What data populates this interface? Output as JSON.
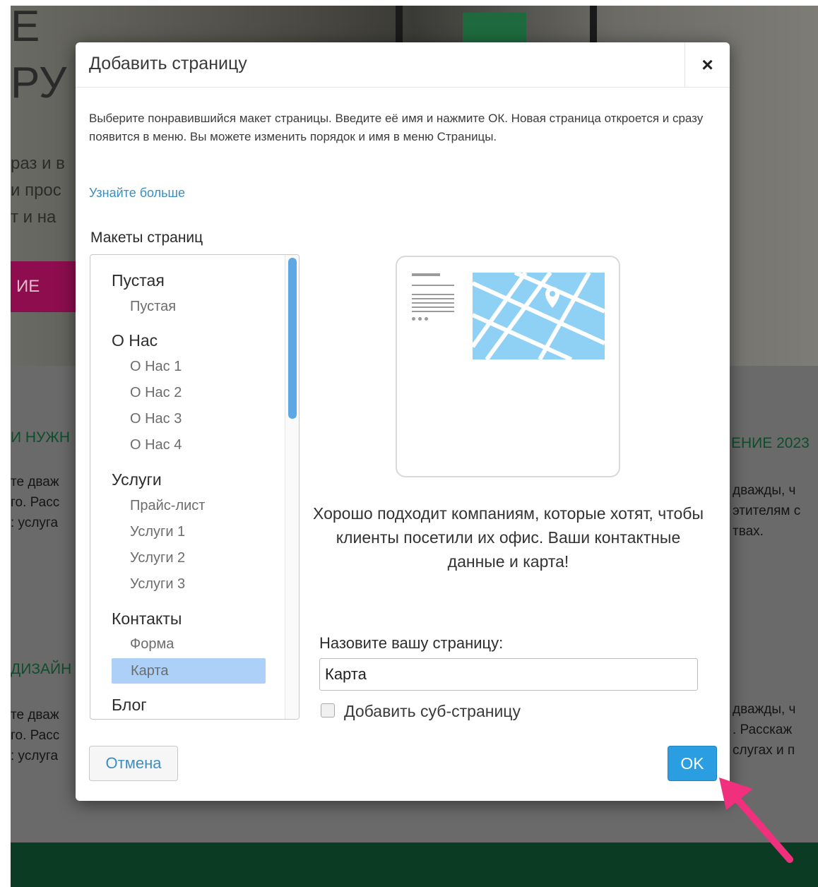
{
  "background": {
    "hero_title": "Е\nРУ",
    "hero_lines": [
      "раз и в",
      "и прос",
      "т и на"
    ],
    "hero_button": "ИЕ",
    "left_heading_1": "И НУЖН",
    "left_text_1": [
      "те дваж",
      "го. Расс",
      ": услуга"
    ],
    "right_heading_1": "ЕНИЕ 2023",
    "right_text_1": [
      "дважды, ч",
      "этителям с",
      "твах."
    ],
    "left_heading_2": "ДИЗАЙН",
    "left_text_2": [
      "те дваж",
      "го. Расс",
      ": услуга"
    ],
    "right_text_2": [
      "дважды, ч",
      ". Расскаж",
      "слугах и п"
    ]
  },
  "dialog": {
    "title": "Добавить страницу",
    "close_label": "×",
    "description": "Выберите понравившийся макет страницы. Введите её имя и нажмите ОК. Новая страница откроется и сразу появится в меню. Вы можете изменить порядок и имя в меню Страницы.",
    "learn_more": "Узнайте больше",
    "layouts_label": "Макеты страниц",
    "groups": [
      {
        "title": "Пустая",
        "items": [
          "Пустая"
        ]
      },
      {
        "title": "О Нас",
        "items": [
          "О Нас 1",
          "О Нас 2",
          "О Нас 3",
          "О Нас 4"
        ]
      },
      {
        "title": "Услуги",
        "items": [
          "Прайс-лист",
          "Услуги 1",
          "Услуги 2",
          "Услуги 3"
        ]
      },
      {
        "title": "Контакты",
        "items": [
          "Форма",
          "Карта"
        ]
      },
      {
        "title": "Блог",
        "items": []
      }
    ],
    "selected_item": "Карта",
    "preview_description": "Хорошо подходит компаниям, которые хотят, чтобы клиенты посетили их офис. Ваши контактные данные и карта!",
    "name_label": "Назовите вашу страницу:",
    "name_value": "Карта",
    "subpage_label": "Добавить суб-страницу",
    "subpage_checked": false,
    "cancel_label": "Отмена",
    "ok_label": "OK"
  },
  "colors": {
    "accent": "#2a9ee0",
    "link": "#3a8fc0",
    "selection": "#acd0f7",
    "arrow": "#f0307c"
  }
}
